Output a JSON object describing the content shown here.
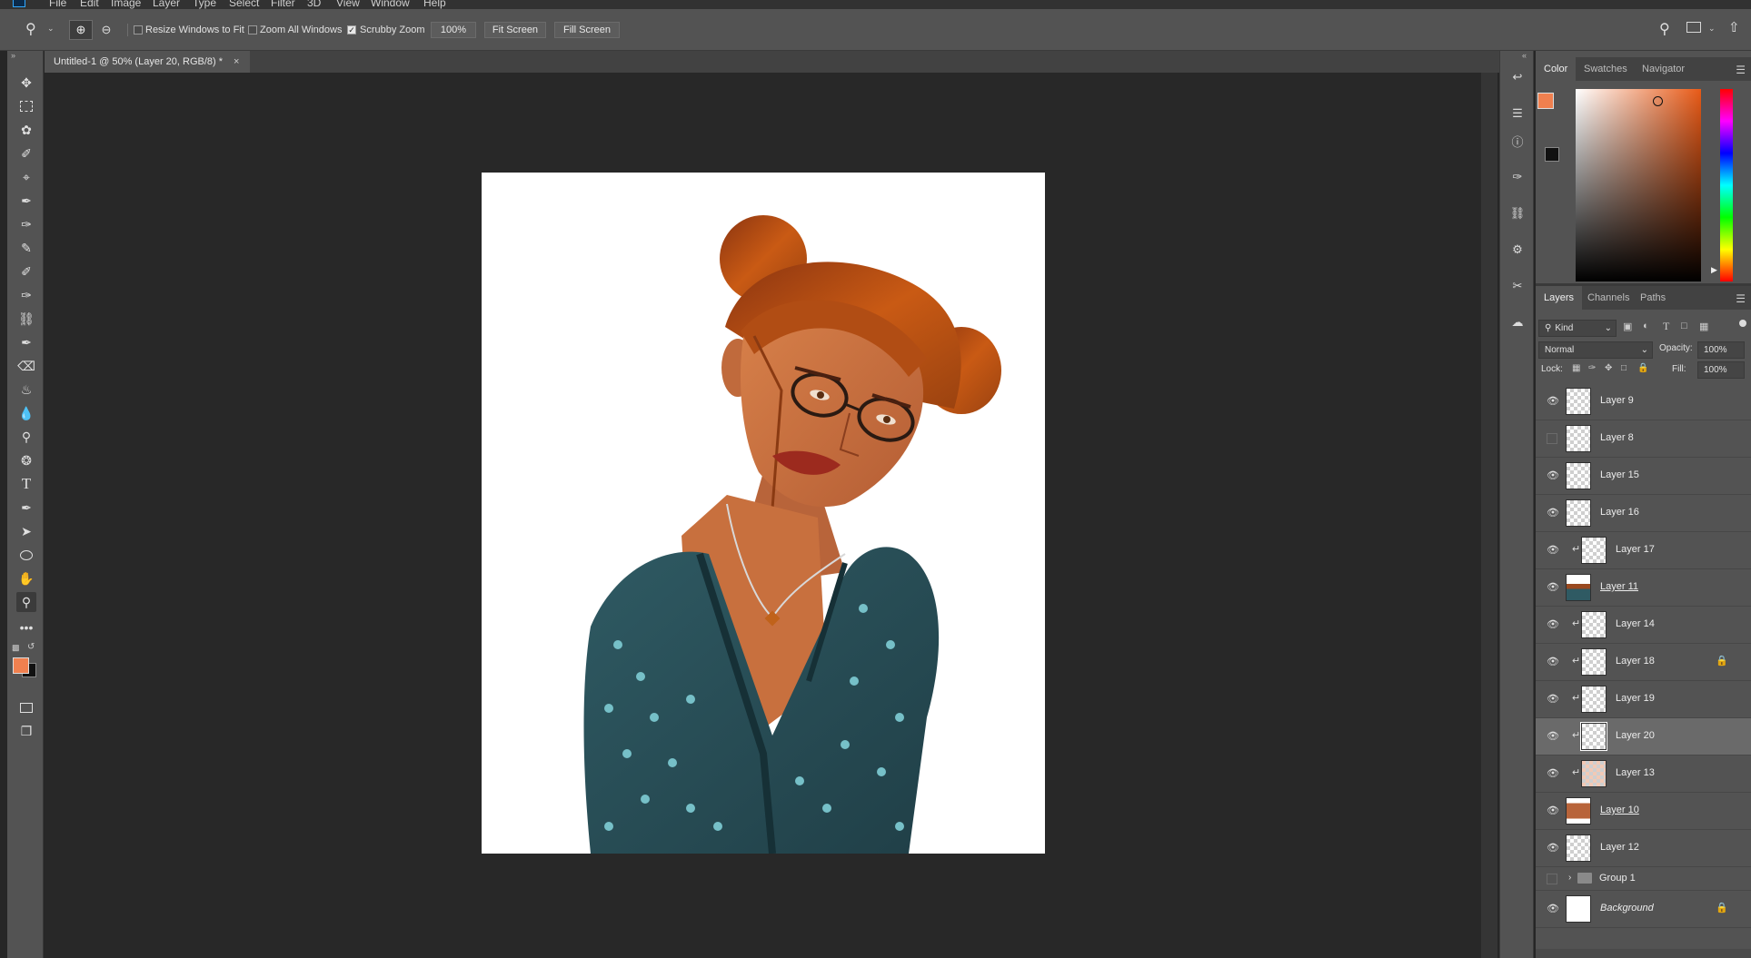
{
  "menu": [
    "File",
    "Edit",
    "Image",
    "Layer",
    "Type",
    "Select",
    "Filter",
    "3D",
    "View",
    "Window",
    "Help"
  ],
  "options": {
    "resize_windows": "Resize Windows to Fit",
    "zoom_all": "Zoom All Windows",
    "scrubby": "Scrubby Zoom",
    "zoom_value": "100%",
    "fit_screen": "Fit Screen",
    "fill_screen": "Fill Screen"
  },
  "document": {
    "tab_title": "Untitled-1 @ 50% (Layer 20, RGB/8) *",
    "close": "×"
  },
  "colors": {
    "foreground": "#f0804f",
    "background": "#111111",
    "accent": "#31a8ff"
  },
  "color_panel": {
    "tabs": [
      "Color",
      "Swatches",
      "Navigator"
    ],
    "active": "Color"
  },
  "layers_panel": {
    "tabs": [
      "Layers",
      "Channels",
      "Paths"
    ],
    "active": "Layers",
    "filter_kind": "Kind",
    "blend_mode": "Normal",
    "opacity_label": "Opacity:",
    "opacity_value": "100%",
    "lock_label": "Lock:",
    "fill_label": "Fill:",
    "fill_value": "100%",
    "layers": [
      {
        "name": "Layer 9",
        "visible": true,
        "clipped": false,
        "locked": false,
        "thumb": "empty",
        "selected": false
      },
      {
        "name": "Layer 8",
        "visible": false,
        "clipped": false,
        "locked": false,
        "thumb": "empty",
        "selected": false
      },
      {
        "name": "Layer 15",
        "visible": true,
        "clipped": false,
        "locked": false,
        "thumb": "empty",
        "selected": false
      },
      {
        "name": "Layer 16",
        "visible": true,
        "clipped": false,
        "locked": false,
        "thumb": "empty",
        "selected": false
      },
      {
        "name": "Layer 17",
        "visible": true,
        "clipped": true,
        "locked": false,
        "thumb": "empty",
        "selected": false
      },
      {
        "name": "Layer 11",
        "visible": true,
        "clipped": false,
        "locked": false,
        "thumb": "figure",
        "selected": false
      },
      {
        "name": "Layer 14",
        "visible": true,
        "clipped": true,
        "locked": false,
        "thumb": "empty",
        "selected": false
      },
      {
        "name": "Layer 18",
        "visible": true,
        "clipped": true,
        "locked": true,
        "thumb": "empty",
        "selected": false
      },
      {
        "name": "Layer 19",
        "visible": true,
        "clipped": true,
        "locked": false,
        "thumb": "empty",
        "selected": false
      },
      {
        "name": "Layer 20",
        "visible": true,
        "clipped": true,
        "locked": false,
        "thumb": "empty",
        "selected": true
      },
      {
        "name": "Layer 13",
        "visible": true,
        "clipped": true,
        "locked": false,
        "thumb": "skin",
        "selected": false
      },
      {
        "name": "Layer 10",
        "visible": true,
        "clipped": false,
        "locked": false,
        "thumb": "face",
        "selected": false
      },
      {
        "name": "Layer 12",
        "visible": true,
        "clipped": false,
        "locked": false,
        "thumb": "empty",
        "selected": false
      }
    ],
    "group": {
      "name": "Group 1",
      "visible": false
    },
    "background": {
      "name": "Background",
      "visible": true,
      "locked": true
    }
  }
}
